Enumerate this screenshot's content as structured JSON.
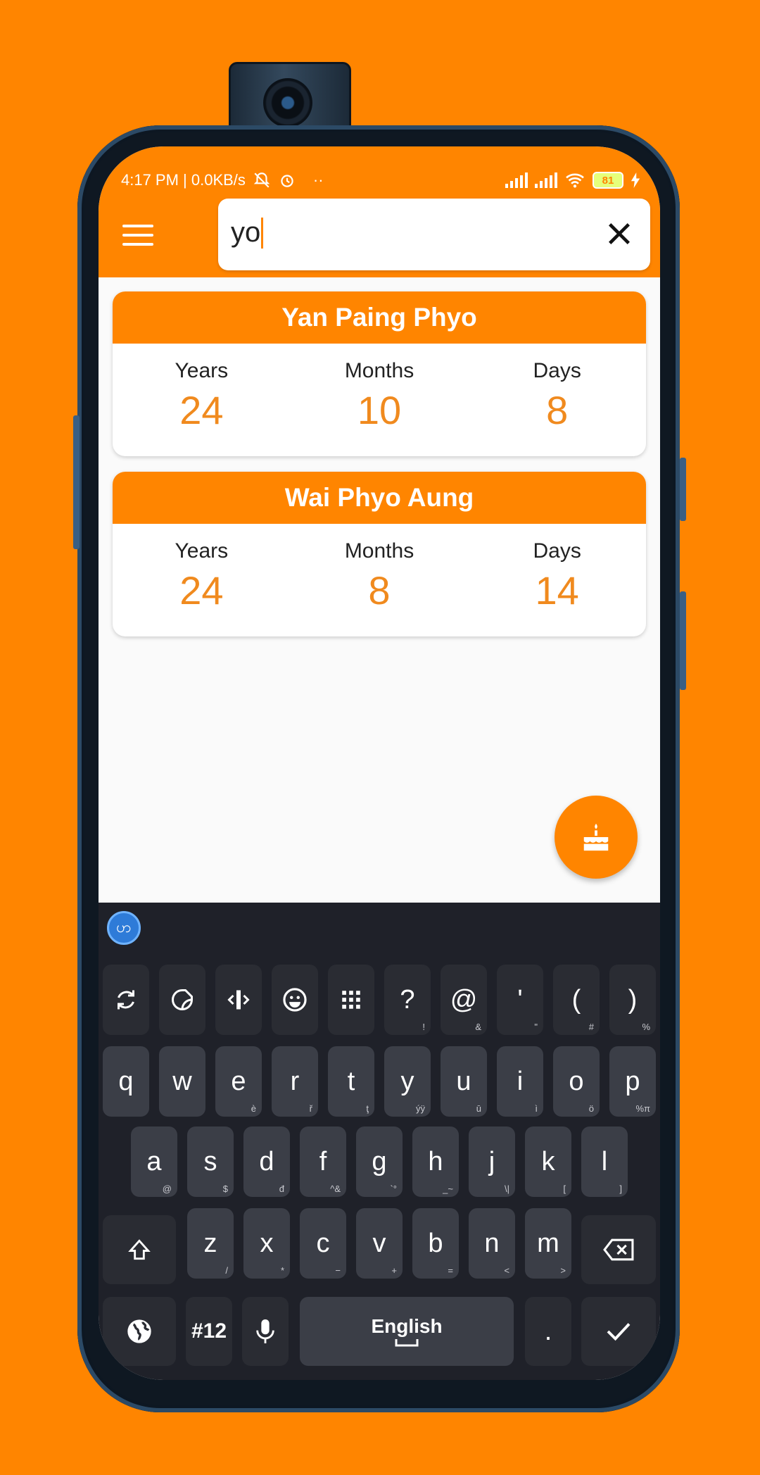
{
  "status_bar": {
    "time_info": "4:17 PM | 0.0KB/s",
    "extra": "··",
    "battery": "81"
  },
  "search": {
    "value": "yo"
  },
  "people": [
    {
      "name": "Yan Paing Phyo",
      "years_label": "Years",
      "years": "24",
      "months_label": "Months",
      "months": "10",
      "days_label": "Days",
      "days": "8"
    },
    {
      "name": "Wai Phyo Aung",
      "years_label": "Years",
      "years": "24",
      "months_label": "Months",
      "months": "8",
      "days_label": "Days",
      "days": "14"
    }
  ],
  "keyboard": {
    "logo_glyph": "ဟ",
    "tool_row": [
      {
        "name": "sync-icon",
        "main": "",
        "sub": ""
      },
      {
        "name": "sticker-icon",
        "main": "",
        "sub": ""
      },
      {
        "name": "cursor-move-icon",
        "main": "",
        "sub": ""
      },
      {
        "name": "emoji-icon",
        "main": "",
        "sub": ""
      },
      {
        "name": "numpad-icon",
        "main": "",
        "sub": ""
      },
      {
        "name": "question",
        "main": "?",
        "sub": "!"
      },
      {
        "name": "at",
        "main": "@",
        "sub": "&"
      },
      {
        "name": "apostrophe",
        "main": "'",
        "sub": "\""
      },
      {
        "name": "open-paren",
        "main": "(",
        "sub": "#"
      },
      {
        "name": "close-paren",
        "main": ")",
        "sub": "%"
      }
    ],
    "row1": [
      {
        "main": "q",
        "sub": ""
      },
      {
        "main": "w",
        "sub": ""
      },
      {
        "main": "e",
        "sub": "è"
      },
      {
        "main": "r",
        "sub": "ř"
      },
      {
        "main": "t",
        "sub": "ţ"
      },
      {
        "main": "y",
        "sub": "ýÿ"
      },
      {
        "main": "u",
        "sub": "ū"
      },
      {
        "main": "i",
        "sub": "ì"
      },
      {
        "main": "o",
        "sub": "ö"
      },
      {
        "main": "p",
        "sub": "%π"
      }
    ],
    "row2": [
      {
        "main": "a",
        "sub": "@"
      },
      {
        "main": "s",
        "sub": "$"
      },
      {
        "main": "d",
        "sub": "đ"
      },
      {
        "main": "f",
        "sub": "^&"
      },
      {
        "main": "g",
        "sub": "`°"
      },
      {
        "main": "h",
        "sub": "_~"
      },
      {
        "main": "j",
        "sub": "\\|"
      },
      {
        "main": "k",
        "sub": "["
      },
      {
        "main": "l",
        "sub": "]"
      }
    ],
    "row3": [
      {
        "main": "z",
        "sub": "/"
      },
      {
        "main": "x",
        "sub": "*"
      },
      {
        "main": "c",
        "sub": "−"
      },
      {
        "main": "v",
        "sub": "+"
      },
      {
        "main": "b",
        "sub": "="
      },
      {
        "main": "n",
        "sub": "<"
      },
      {
        "main": "m",
        "sub": ">"
      }
    ],
    "numbers_label": "#12",
    "space_label": "English",
    "period_label": "."
  }
}
